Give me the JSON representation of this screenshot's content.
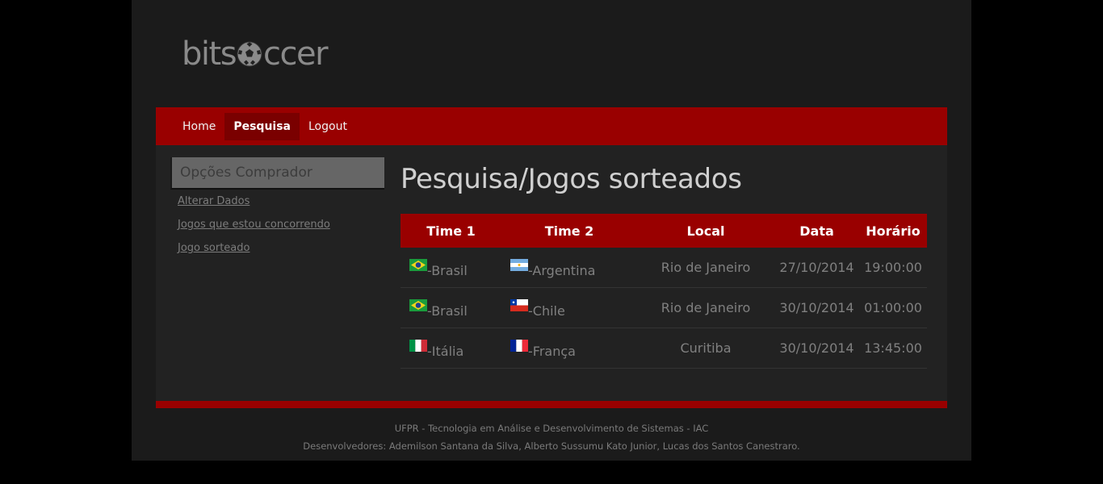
{
  "logo": {
    "text_before": "bits",
    "text_after": "ccer",
    "icon": "soccer-ball-icon"
  },
  "nav": {
    "home": "Home",
    "pesquisa": "Pesquisa",
    "logout": "Logout"
  },
  "sidebar": {
    "title": "Opções Comprador",
    "links": [
      "Alterar Dados",
      "Jogos que estou concorrendo",
      "Jogo sorteado"
    ]
  },
  "main": {
    "title": "Pesquisa/Jogos sorteados",
    "columns": [
      "Time 1",
      "Time 2",
      "Local",
      "Data",
      "Horário"
    ],
    "rows": [
      {
        "team1": "-Brasil",
        "team1_flag": "brazil-flag-icon",
        "team2": "-Argentina",
        "team2_flag": "argentina-flag-icon",
        "local": "Rio de Janeiro",
        "data": "27/10/2014",
        "horario": "19:00:00"
      },
      {
        "team1": "-Brasil",
        "team1_flag": "brazil-flag-icon",
        "team2": "-Chile",
        "team2_flag": "chile-flag-icon",
        "local": "Rio de Janeiro",
        "data": "30/10/2014",
        "horario": "01:00:00"
      },
      {
        "team1": "-Itália",
        "team1_flag": "italy-flag-icon",
        "team2": "-França",
        "team2_flag": "france-flag-icon",
        "local": "Curitiba",
        "data": "30/10/2014",
        "horario": "13:45:00"
      }
    ]
  },
  "footer": {
    "line1": "UFPR - Tecnologia em Análise e Desenvolvimento de Sistemas - IAC",
    "line2": "Desenvolvedores: Ademilson Santana da Silva, Alberto Sussumu Kato Junior, Lucas dos Santos Canestraro."
  },
  "colors": {
    "accent": "#990000",
    "nav_active": "#7a0000",
    "page_bg": "#1b1b1b",
    "content_bg": "#222222"
  }
}
